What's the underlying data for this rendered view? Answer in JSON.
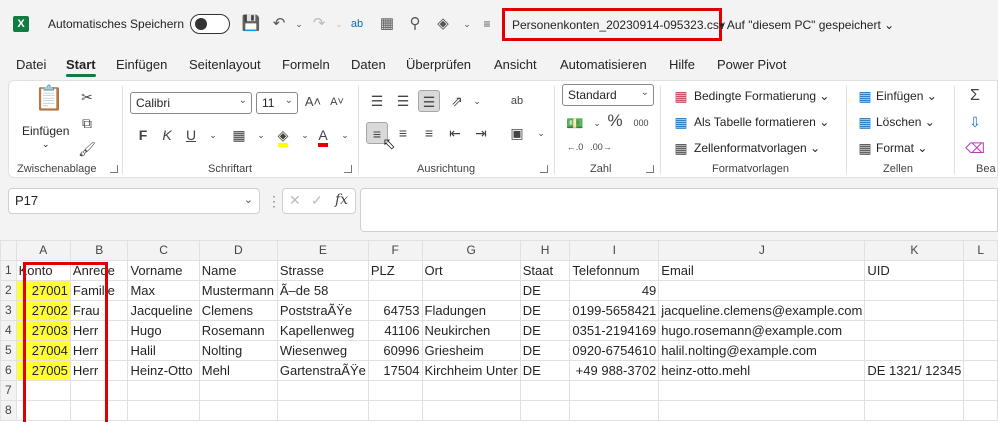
{
  "app": {
    "autosave_label": "Automatisches Speichern",
    "filename": "Personenkonten_20230914-095323.csv",
    "save_location": "• Auf \"diesem PC\" gespeichert",
    "accent": "#107c41",
    "highlight_color": "#e00000"
  },
  "menu": {
    "tabs": [
      "Datei",
      "Start",
      "Einfügen",
      "Seitenlayout",
      "Formeln",
      "Daten",
      "Überprüfen",
      "Ansicht",
      "Automatisieren",
      "Hilfe",
      "Power Pivot"
    ],
    "active": "Start"
  },
  "ribbon": {
    "clipboard": {
      "paste": "Einfügen",
      "label": "Zwischenablage"
    },
    "font": {
      "name": "Calibri",
      "size": "11",
      "bold": "F",
      "italic": "K",
      "underline": "U",
      "label": "Schriftart",
      "grow": "A˄",
      "shrink": "A˅"
    },
    "alignment": {
      "label": "Ausrichtung"
    },
    "number": {
      "format": "Standard",
      "percent": "%",
      "thousands": "000",
      "label": "Zahl"
    },
    "styles": {
      "conditional": "Bedingte Formatierung",
      "as_table": "Als Tabelle formatieren",
      "cell_styles": "Zellenformatvorlagen",
      "label": "Formatvorlagen"
    },
    "cells": {
      "insert": "Einfügen",
      "delete": "Löschen",
      "format": "Format",
      "label": "Zellen"
    },
    "editing": {
      "label": "Bea"
    }
  },
  "formula_bar": {
    "name_box": "P17",
    "fx": "fx",
    "formula": ""
  },
  "grid": {
    "columns": [
      "A",
      "B",
      "C",
      "D",
      "E",
      "F",
      "G",
      "H",
      "I",
      "J",
      "K",
      "L"
    ],
    "rows": [
      {
        "n": "1",
        "cells": [
          "Konto",
          "Anrede",
          "Vorname",
          "Name",
          "Strasse",
          "PLZ",
          "Ort",
          "Staat",
          "Telefonnum",
          "Email",
          "UID",
          ""
        ]
      },
      {
        "n": "2",
        "cells": [
          "27001",
          "Familie",
          "Max",
          "Mustermann",
          "Ã–de 58",
          "",
          "",
          "DE",
          "49",
          "",
          "",
          ""
        ]
      },
      {
        "n": "3",
        "cells": [
          "27002",
          "Frau",
          "Jacqueline",
          "Clemens",
          "PoststraÃŸe",
          "64753",
          "Fladungen",
          "DE",
          "0199-5658421",
          "jacqueline.clemens@example.com",
          "",
          ""
        ]
      },
      {
        "n": "4",
        "cells": [
          "27003",
          "Herr",
          "Hugo",
          "Rosemann",
          "Kapellenweg",
          "41106",
          "Neukirchen",
          "DE",
          "0351-2194169",
          "hugo.rosemann@example.com",
          "",
          ""
        ]
      },
      {
        "n": "5",
        "cells": [
          "27004",
          "Herr",
          "Halil",
          "Nolting",
          "Wiesenweg",
          "60996",
          "Griesheim",
          "DE",
          "0920-6754610",
          "halil.nolting@example.com",
          "",
          ""
        ]
      },
      {
        "n": "6",
        "cells": [
          "27005",
          "Herr",
          "Heinz-Otto",
          "Mehl",
          "GartenstraÃŸe",
          "17504",
          "Kirchheim Unter",
          "DE",
          "+49 988-3702",
          "heinz-otto.mehl",
          "DE 1321/ 12345",
          ""
        ]
      },
      {
        "n": "7",
        "cells": [
          "",
          "",
          "",
          "",
          "",
          "",
          "",
          "",
          "",
          "",
          "",
          ""
        ]
      },
      {
        "n": "8",
        "cells": [
          "",
          "",
          "",
          "",
          "",
          "",
          "",
          "",
          "",
          "",
          "",
          ""
        ]
      }
    ]
  }
}
